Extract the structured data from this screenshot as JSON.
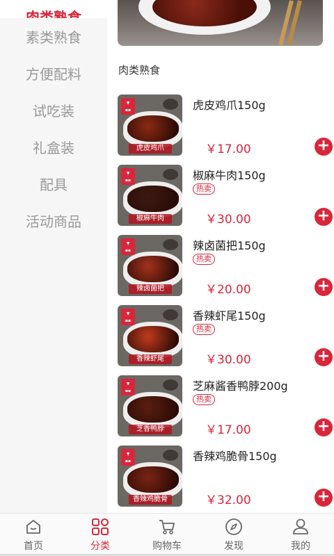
{
  "sidebar": {
    "items": [
      {
        "label": "肉类熟食",
        "active": true
      },
      {
        "label": "素类熟食",
        "active": false
      },
      {
        "label": "方便配料",
        "active": false
      },
      {
        "label": "试吃装",
        "active": false
      },
      {
        "label": "礼盒装",
        "active": false
      },
      {
        "label": "配具",
        "active": false
      },
      {
        "label": "活动商品",
        "active": false
      }
    ]
  },
  "main": {
    "section_title": "肉类熟食",
    "products": [
      {
        "name": "虎皮鸡爪150g",
        "tag": "",
        "price": "￥17.00",
        "caption": "虎皮鸡爪",
        "food_color": "#8a2a14"
      },
      {
        "name": "椒麻牛肉150g",
        "tag": "热卖",
        "price": "￥30.00",
        "caption": "椒麻牛肉",
        "food_color": "#3a1a10"
      },
      {
        "name": "辣卤菌把150g",
        "tag": "热卖",
        "price": "￥20.00",
        "caption": "辣卤菌把",
        "food_color": "#a2321c"
      },
      {
        "name": "香辣虾尾150g",
        "tag": "热卖",
        "price": "￥30.00",
        "caption": "香辣虾尾",
        "food_color": "#c03a1c"
      },
      {
        "name": "芝麻酱香鸭脖200g",
        "tag": "热卖",
        "price": "￥17.00",
        "caption": "芝香鸭脖",
        "food_color": "#5a1e10"
      },
      {
        "name": "香辣鸡脆骨150g",
        "tag": "",
        "price": "￥32.00",
        "caption": "香辣鸡脆骨",
        "food_color": "#7a2414"
      }
    ]
  },
  "tabbar": {
    "items": [
      {
        "label": "首页",
        "icon": "home-icon",
        "active": false
      },
      {
        "label": "分类",
        "icon": "category-icon",
        "active": true
      },
      {
        "label": "购物车",
        "icon": "cart-icon",
        "active": false
      },
      {
        "label": "发现",
        "icon": "compass-icon",
        "active": false
      },
      {
        "label": "我的",
        "icon": "user-icon",
        "active": false
      }
    ]
  },
  "colors": {
    "accent": "#d9263a",
    "sidebar_bg": "#f6f6f6",
    "inactive_text": "#999999"
  }
}
